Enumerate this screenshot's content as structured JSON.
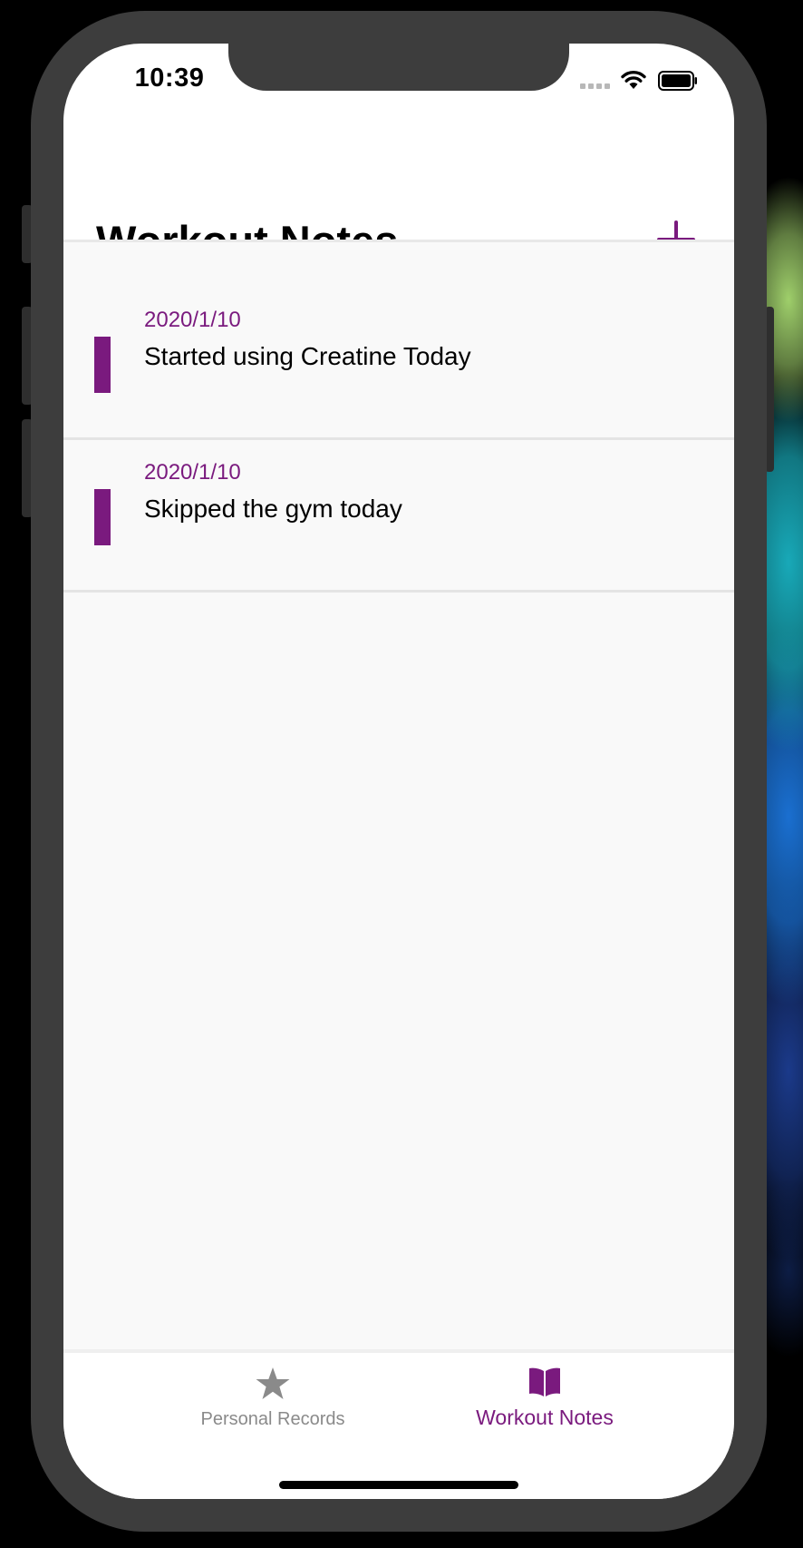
{
  "colors": {
    "accent": "#7a1a7e",
    "inactive": "#8a8a8a",
    "text": "#000000",
    "list_background": "#f9f9f9"
  },
  "status_bar": {
    "time": "10:39",
    "wifi_icon": "wifi-icon",
    "battery_icon": "battery-icon"
  },
  "header": {
    "title": "Workout Notes",
    "add_icon": "plus-icon"
  },
  "notes": [
    {
      "date": "2020/1/10",
      "text": "Started using Creatine Today"
    },
    {
      "date": "2020/1/10",
      "text": "Skipped the gym today"
    }
  ],
  "tab_bar": {
    "tabs": [
      {
        "label": "Personal Records",
        "icon": "star-icon",
        "selected": false
      },
      {
        "label": "Workout Notes",
        "icon": "book-icon",
        "selected": true
      }
    ]
  }
}
